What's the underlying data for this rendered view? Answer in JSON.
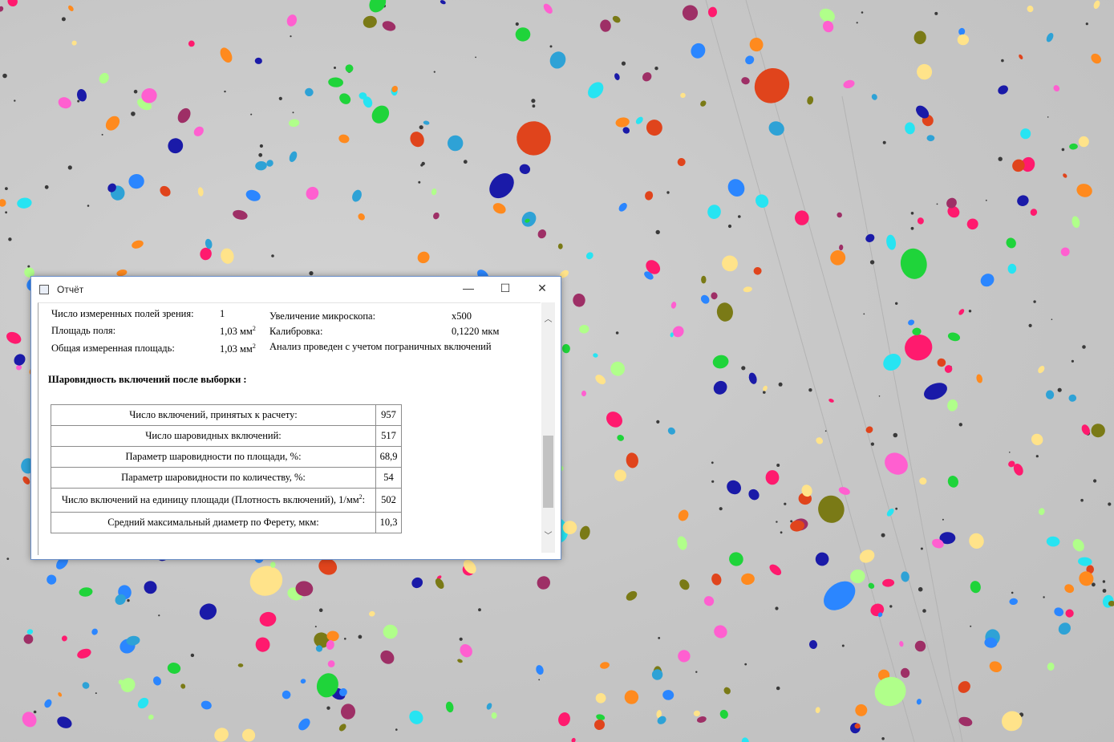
{
  "window": {
    "title": "Отчёт",
    "minimize": "—",
    "maximize": "☐",
    "close": "✕"
  },
  "info": {
    "fields_label": "Число измеренных полей зрения:",
    "fields_value": "1",
    "field_area_label": "Площадь поля:",
    "field_area_value": "1,03 мм",
    "total_area_label": "Общая измеренная площадь:",
    "total_area_value": "1,03 мм",
    "magnification_label": "Увеличение микроскопа:",
    "magnification_value": "x500",
    "calibration_label": "Калибровка:",
    "calibration_value": "0,1220 мкм",
    "border_note": "Анализ проведен с учетом пограничных включений",
    "sup2": "2"
  },
  "section_title": "Шаровидность включений после выборки :",
  "results": [
    {
      "label": "Число включений, принятых к расчету:",
      "value": "957"
    },
    {
      "label": "Число шаровидных включений:",
      "value": "517"
    },
    {
      "label": "Параметр шаровидности по площади, %:",
      "value": "68,9"
    },
    {
      "label": "Параметр шаровидности по количеству, %:",
      "value": "54"
    },
    {
      "label": "Число включений на единицу площади (Плотность включений), 1/мм",
      "label_sup": "2",
      "label_tail": ":",
      "value": "502"
    },
    {
      "label": "Средний максимальный диаметр по Ферету, мкм:",
      "value": "10,3"
    }
  ],
  "scroll": {
    "up": "︿",
    "down": "﹀"
  },
  "inclusion_colors": [
    "#ff1a6e",
    "#2b86ff",
    "#ff8a1e",
    "#1fd43a",
    "#1a1aa8",
    "#ff5fd0",
    "#27e4f2",
    "#9e2f66",
    "#ffe38a",
    "#b0ff8a",
    "#7a7a16",
    "#e0441c",
    "#2ea2d6"
  ]
}
